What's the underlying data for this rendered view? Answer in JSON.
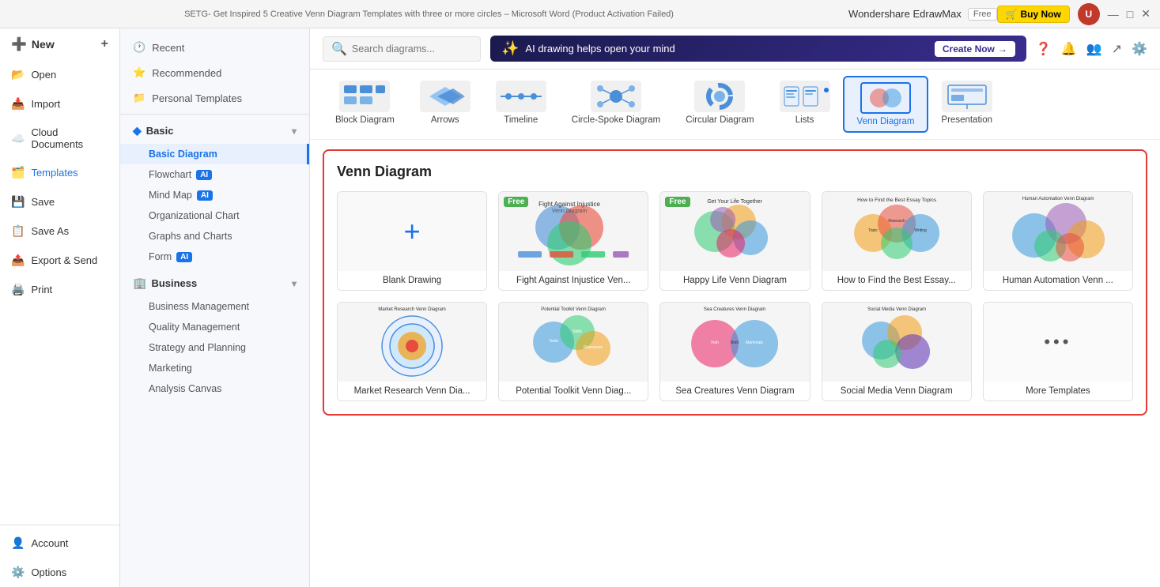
{
  "titlebar": {
    "title": "Wondershare EdrawMax",
    "free_badge": "Free",
    "buy_now": "Buy Now",
    "tab_text": "SETG- Get Inspired 5 Creative Venn Diagram Templates with three or more circles – Microsoft Word (Product Activation Failed)",
    "close": "✕",
    "maximize": "□",
    "minimize": "—"
  },
  "sidebar": {
    "new_label": "New",
    "open_label": "Open",
    "import_label": "Import",
    "cloud_label": "Cloud Documents",
    "templates_label": "Templates",
    "save_label": "Save",
    "save_as_label": "Save As",
    "export_label": "Export & Send",
    "print_label": "Print",
    "account_label": "Account",
    "options_label": "Options"
  },
  "left_panel": {
    "recent_label": "Recent",
    "recommended_label": "Recommended",
    "personal_label": "Personal Templates",
    "basic_label": "Basic",
    "basic_diagram_label": "Basic Diagram",
    "flowchart_label": "Flowchart",
    "mind_map_label": "Mind Map",
    "org_chart_label": "Organizational Chart",
    "graphs_label": "Graphs and Charts",
    "form_label": "Form",
    "business_label": "Business",
    "biz_mgmt_label": "Business Management",
    "quality_label": "Quality Management",
    "strategy_label": "Strategy and Planning",
    "marketing_label": "Marketing",
    "analysis_label": "Analysis Canvas"
  },
  "topbar": {
    "search_placeholder": "Search diagrams...",
    "ai_banner_text": "AI drawing helps open your mind",
    "create_now": "Create Now"
  },
  "diagram_types": [
    {
      "label": "Block Diagram"
    },
    {
      "label": "Arrows"
    },
    {
      "label": "Timeline"
    },
    {
      "label": "Circle-Spoke Diagram"
    },
    {
      "label": "Circular Diagram"
    },
    {
      "label": "Lists"
    },
    {
      "label": "Venn Diagram",
      "selected": true
    },
    {
      "label": "Presentation"
    }
  ],
  "venn_section": {
    "title": "Venn Diagram",
    "templates": [
      {
        "label": "Blank Drawing",
        "type": "blank"
      },
      {
        "label": "Fight Against Injustice Ven...",
        "type": "template",
        "free": true,
        "color": "#4a90d9"
      },
      {
        "label": "Happy Life Venn Diagram",
        "type": "template",
        "free": true,
        "color": "#2ecc71"
      },
      {
        "label": "How to Find the Best Essay...",
        "type": "template",
        "free": false,
        "color": "#e74c3c"
      },
      {
        "label": "Human Automation Venn ...",
        "type": "template",
        "free": false,
        "color": "#9b59b6"
      },
      {
        "label": "Market Research Venn Dia...",
        "type": "template",
        "free": false,
        "color": "#f39c12"
      },
      {
        "label": "Potential Toolkit Venn Diag...",
        "type": "template",
        "free": false,
        "color": "#3498db"
      },
      {
        "label": "Sea Creatures Venn Diagram",
        "type": "template",
        "free": false,
        "color": "#e91e63"
      },
      {
        "label": "Social Media Venn Diagram",
        "type": "template",
        "free": false,
        "color": "#673ab7"
      },
      {
        "label": "More Templates",
        "type": "more"
      }
    ]
  }
}
